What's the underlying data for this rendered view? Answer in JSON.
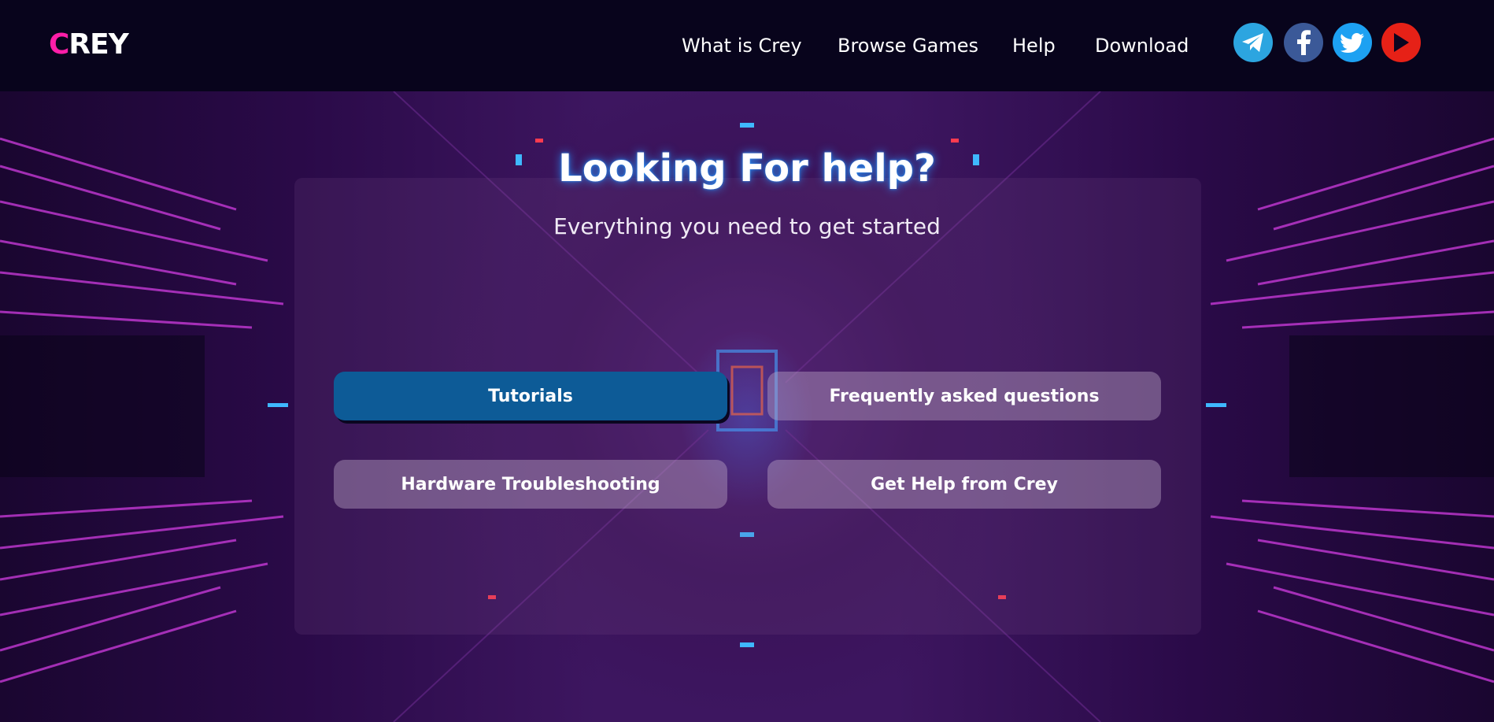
{
  "header": {
    "logo_first": "C",
    "logo_rest": "REY",
    "nav": [
      {
        "label": "What is Crey"
      },
      {
        "label": "Browse Games"
      },
      {
        "label": "Help"
      },
      {
        "label": "Download"
      }
    ],
    "social": [
      {
        "icon": "telegram-icon",
        "color": "#2ca5e0"
      },
      {
        "icon": "facebook-icon",
        "color": "#3b5998"
      },
      {
        "icon": "twitter-icon",
        "color": "#1da1f2"
      },
      {
        "icon": "youtube-icon",
        "color": "#e62117"
      }
    ]
  },
  "hero": {
    "title": "Looking For help?",
    "subtitle": "Everything you need to get started",
    "buttons": [
      {
        "label": "Tutorials",
        "active": true
      },
      {
        "label": "Frequently asked questions",
        "active": false
      },
      {
        "label": "Hardware Troubleshooting",
        "active": false
      },
      {
        "label": "Get Help from Crey",
        "active": false
      }
    ]
  },
  "colors": {
    "header_bg": "#08041c",
    "accent_pink": "#ff1ea8",
    "primary_button": "#0d5b97",
    "title_glow": "#2896ff"
  }
}
